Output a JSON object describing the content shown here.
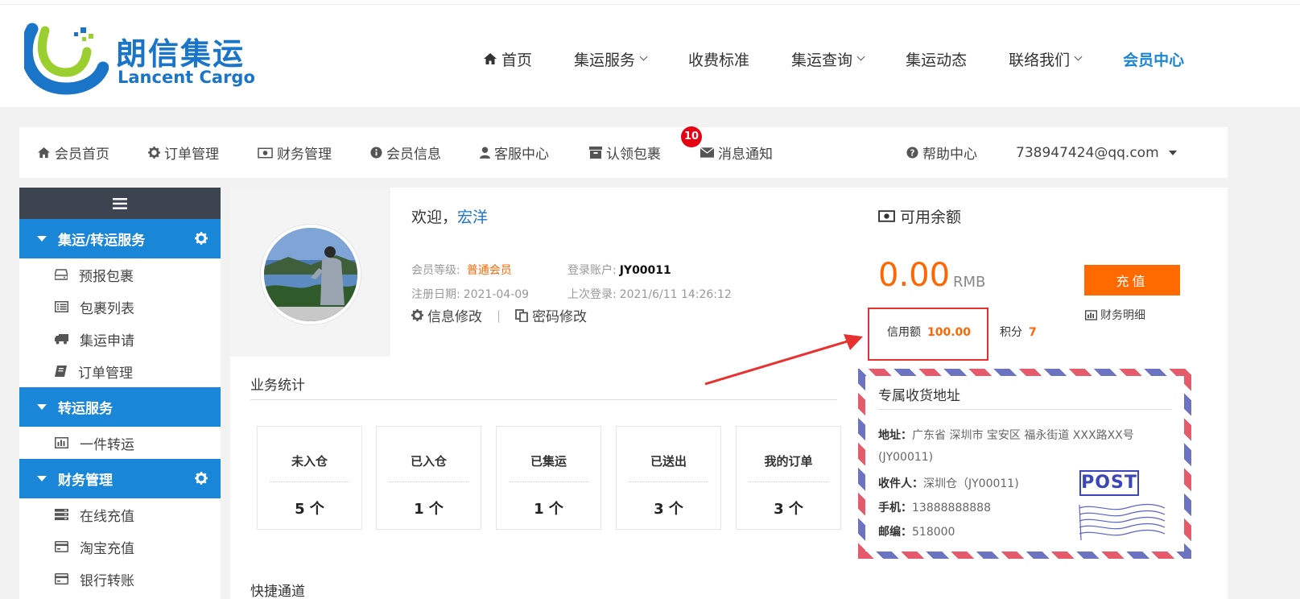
{
  "brand": {
    "name_cn": "朗信集运",
    "name_en": "Lancent Cargo"
  },
  "main_nav": [
    {
      "label": "首页",
      "icon": "home-icon",
      "dropdown": false
    },
    {
      "label": "集运服务",
      "dropdown": true
    },
    {
      "label": "收费标准",
      "dropdown": false
    },
    {
      "label": "集运查询",
      "dropdown": true
    },
    {
      "label": "集运动态",
      "dropdown": false
    },
    {
      "label": "联络我们",
      "dropdown": true
    },
    {
      "label": "会员中心",
      "dropdown": false,
      "active": true
    }
  ],
  "member_nav": {
    "items": [
      {
        "label": "会员首页",
        "icon": "home-icon"
      },
      {
        "label": "订单管理",
        "icon": "gear-icon"
      },
      {
        "label": "财务管理",
        "icon": "money-icon"
      },
      {
        "label": "会员信息",
        "icon": "info-icon"
      },
      {
        "label": "客服中心",
        "icon": "user-icon"
      },
      {
        "label": "认领包裹",
        "icon": "archive-icon"
      },
      {
        "label": "消息通知",
        "icon": "envelope-icon"
      },
      {
        "label": "帮助中心",
        "icon": "question-icon"
      }
    ],
    "claim_badge": "10",
    "account": "738947424@qq.com"
  },
  "sidebar": {
    "sections": [
      {
        "title": "集运/转运服务",
        "items": [
          "预报包裹",
          "包裹列表",
          "集运申请",
          "订单管理"
        ]
      },
      {
        "title": "转运服务",
        "items": [
          "一件转运"
        ]
      },
      {
        "title": "财务管理",
        "items": [
          "在线充值",
          "淘宝充值",
          "银行转账"
        ]
      }
    ]
  },
  "profile": {
    "welcome_prefix": "欢迎，",
    "name": "宏洋",
    "level_label": "会员等级:",
    "level_value": "普通会员",
    "account_label": "登录账户:",
    "account_value": "JY00011",
    "reg_label": "注册日期:",
    "reg_value": "2021-04-09",
    "last_label": "上次登录:",
    "last_value": "2021/6/11 14:26:12",
    "edit_info": "信息修改",
    "sep": "|",
    "edit_pwd": "密码修改"
  },
  "stats": {
    "title": "业务统计",
    "cards": [
      {
        "label": "未入仓",
        "value": "5 个"
      },
      {
        "label": "已入仓",
        "value": "1 个"
      },
      {
        "label": "已集运",
        "value": "1 个"
      },
      {
        "label": "已送出",
        "value": "3 个"
      },
      {
        "label": "我的订单",
        "value": "3 个"
      }
    ]
  },
  "quick": {
    "title": "快捷通道"
  },
  "balance": {
    "title": "可用余额",
    "amount": "0.00",
    "unit": "RMB",
    "recharge": "充值",
    "finance_detail": "财务明细",
    "credit_label": "信用额",
    "credit_value": "100.00",
    "points_label": "积分",
    "points_value": "7"
  },
  "address": {
    "title": "专属收货地址",
    "addr_label": "地址：",
    "addr_value": "广东省 深圳市 宝安区 福永街道 XXX路XX号",
    "addr_code": "(JY00011)",
    "recipient_label": "收件人：",
    "recipient_value": "深圳仓（JY00011)",
    "phone_label": "手机：",
    "phone_value": "13888888888",
    "zip_label": "邮编：",
    "zip_value": "518000",
    "stamp": "POST"
  },
  "colors": {
    "brand_blue": "#1a86d8",
    "accent_orange": "#ff6600",
    "highlight_red": "#e8312f",
    "sidebar_dark": "#3c4450"
  }
}
